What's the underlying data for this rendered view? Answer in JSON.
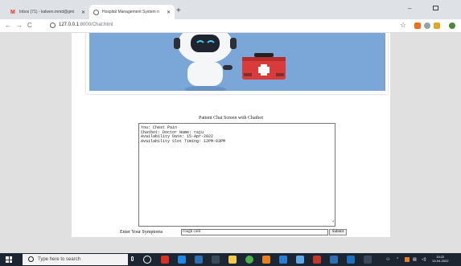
{
  "browser": {
    "tabs": [
      {
        "title": "Inbox (71) - kalwen.mmd@gmi",
        "icon": "gmail-icon",
        "active": false
      },
      {
        "title": "Hospital Management System n",
        "icon": "globe-icon",
        "active": true
      }
    ],
    "new_tab": "+",
    "url": "127.0.0.1:8000/Chat.html",
    "url_host": "127.0.0.1",
    "url_rest": ":8000/Chat.html"
  },
  "page": {
    "banner": {
      "image": "medical-robot-with-first-aid-kit"
    },
    "chat_title": "Patient Chat Screen with Chatbot",
    "chat_lines": [
      "You: Chest Pain",
      "Chatbot: Doctor Name: raju",
      "Availability Date: 15-Apr-2022",
      "Availability Slot Timing: 12PM-03PM"
    ],
    "symptoms_label": "Enter Your Symptoms",
    "symptoms_value": "cough cold",
    "submit_label": "Submit"
  },
  "taskbar": {
    "search_placeholder": "Type here to search",
    "time": "15:22",
    "date": "13-04-2022"
  },
  "colors": {
    "banner_blue": "#7aa7d8",
    "kit_red": "#d93a3a",
    "taskbar": "#1c2532"
  }
}
